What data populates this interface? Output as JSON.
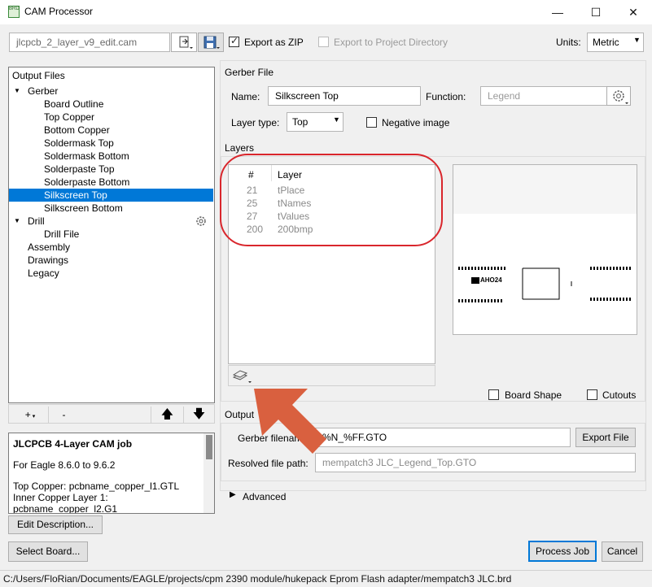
{
  "window": {
    "title": "CAM Processor",
    "minimize": "—",
    "maximize": "☐",
    "close": "✕"
  },
  "toolbar": {
    "job_file": "jlcpcb_2_layer_v9_edit.cam",
    "export_zip_label": "Export as ZIP",
    "export_zip_checked": true,
    "export_project_dir_label": "Export to Project Directory",
    "units_label": "Units:",
    "units_value": "Metric"
  },
  "output_files": {
    "header": "Output Files",
    "items": [
      {
        "label": "Gerber",
        "level": 0,
        "expander": "▼"
      },
      {
        "label": "Board Outline",
        "level": 1
      },
      {
        "label": "Top Copper",
        "level": 1
      },
      {
        "label": "Bottom Copper",
        "level": 1
      },
      {
        "label": "Soldermask Top",
        "level": 1
      },
      {
        "label": "Soldermask Bottom",
        "level": 1
      },
      {
        "label": "Solderpaste Top",
        "level": 1
      },
      {
        "label": "Solderpaste Bottom",
        "level": 1
      },
      {
        "label": "Silkscreen Top",
        "level": 1,
        "selected": true
      },
      {
        "label": "Silkscreen Bottom",
        "level": 1
      },
      {
        "label": "Drill",
        "level": 0,
        "expander": "▼"
      },
      {
        "label": "Drill File",
        "level": 1
      },
      {
        "label": "Assembly",
        "level": 0
      },
      {
        "label": "Drawings",
        "level": 0
      },
      {
        "label": "Legacy",
        "level": 0
      }
    ],
    "add_label": "+",
    "remove_label": "-"
  },
  "description": {
    "title": "JLCPCB 4-Layer CAM job",
    "line1": "For Eagle 8.6.0 to 9.6.2",
    "line2": "Top Copper: pcbname_copper_l1.GTL",
    "line3": "Inner Copper Layer 1:",
    "line4": "pcbname_copper_l2.G1",
    "edit_button": "Edit Description..."
  },
  "gerber_file": {
    "section_title": "Gerber File",
    "name_label": "Name:",
    "name_value": "Silkscreen Top",
    "function_label": "Function:",
    "function_placeholder": "Legend",
    "layer_type_label": "Layer type:",
    "layer_type_value": "Top",
    "negative_label": "Negative image"
  },
  "layers": {
    "section_title": "Layers",
    "col_num": "#",
    "col_layer": "Layer",
    "rows": [
      {
        "num": "21",
        "name": "tPlace"
      },
      {
        "num": "25",
        "name": "tNames"
      },
      {
        "num": "27",
        "name": "tValues"
      },
      {
        "num": "200",
        "name": "200bmp"
      }
    ],
    "board_shape_label": "Board Shape",
    "cutouts_label": "Cutouts",
    "preview_text": "AHO24"
  },
  "output": {
    "section_title": "Output",
    "gerber_filename_label": "Gerber filename:",
    "gerber_filename_value": "%N_%FF.GTO",
    "export_file_button": "Export File",
    "resolved_label": "Resolved file path:",
    "resolved_value": "mempatch3 JLC_Legend_Top.GTO"
  },
  "advanced_label": "Advanced",
  "buttons": {
    "select_board": "Select Board...",
    "process_job": "Process Job",
    "cancel": "Cancel"
  },
  "status_bar": "C:/Users/FloRian/Documents/EAGLE/projects/cpm 2390 module/hukepack Eprom Flash adapter/mempatch3 JLC.brd",
  "colors": {
    "selection": "#0078d7",
    "highlight_circle": "#d9262c",
    "arrow": "#d9603f",
    "accent_button_border": "#0078d7"
  }
}
